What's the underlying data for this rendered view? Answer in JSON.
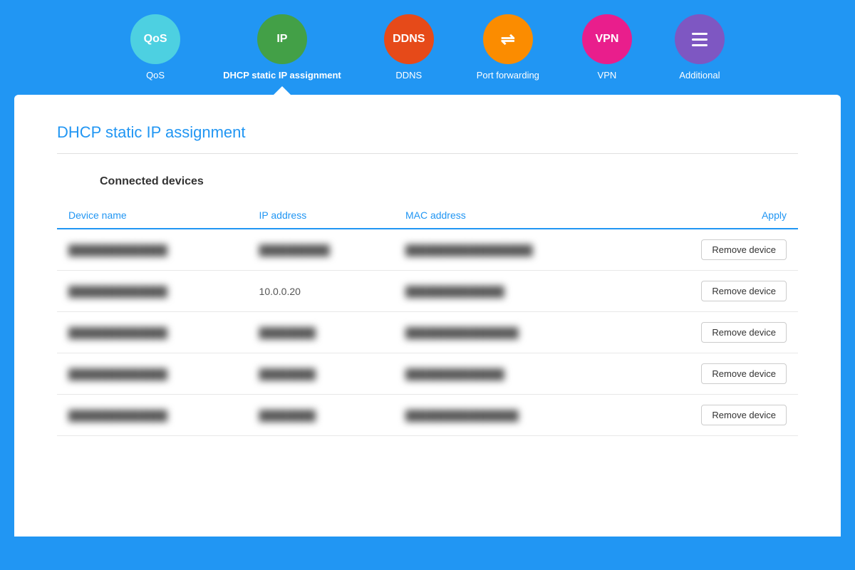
{
  "nav": {
    "items": [
      {
        "id": "qos",
        "label": "QoS",
        "icon_text": "QoS",
        "circle_class": "circle-qos",
        "active": false
      },
      {
        "id": "ip",
        "label": "DHCP static IP assignment",
        "icon_text": "IP",
        "circle_class": "circle-ip",
        "active": true
      },
      {
        "id": "ddns",
        "label": "DDNS",
        "icon_text": "DDNS",
        "circle_class": "circle-ddns",
        "active": false
      },
      {
        "id": "portfwd",
        "label": "Port forwarding",
        "icon_text": "⇌",
        "circle_class": "circle-portfwd",
        "active": false
      },
      {
        "id": "vpn",
        "label": "VPN",
        "icon_text": "VPN",
        "circle_class": "circle-vpn",
        "active": false
      },
      {
        "id": "additional",
        "label": "Additional",
        "icon_text": "≡",
        "circle_class": "circle-additional",
        "active": false
      }
    ]
  },
  "page": {
    "title": "DHCP static IP assignment",
    "subsection": "Connected devices"
  },
  "table": {
    "columns": [
      "Device name",
      "IP address",
      "MAC address",
      "Apply"
    ],
    "rows": [
      {
        "device": "██████████████",
        "ip": "██████████",
        "mac": "██████████████████",
        "blurred": true
      },
      {
        "device": "██████████████",
        "ip": "10.0.0.20",
        "mac": "██████████████",
        "blurred_device": true,
        "blurred_mac": true
      },
      {
        "device": "██████████████",
        "ip": "████████",
        "mac": "████████████████",
        "blurred": true
      },
      {
        "device": "██████████████",
        "ip": "████████",
        "mac": "██████████████",
        "blurred": true
      },
      {
        "device": "██████████████",
        "ip": "████████",
        "mac": "████████████████",
        "blurred": true
      }
    ],
    "remove_button_label": "Remove device"
  }
}
